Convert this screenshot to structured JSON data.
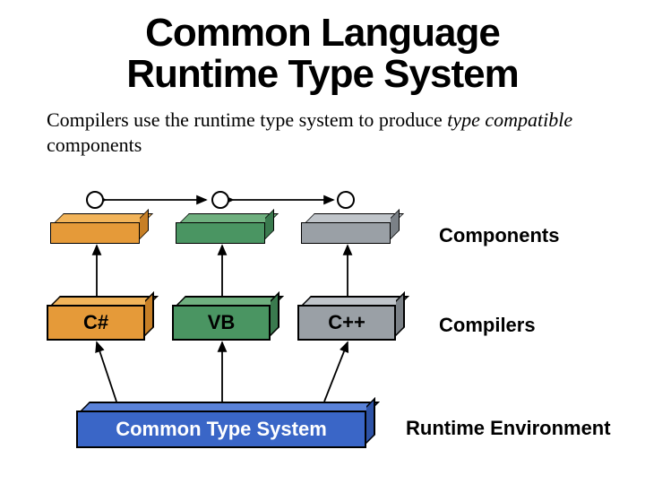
{
  "title_line1": "Common Language",
  "title_line2": "Runtime Type System",
  "subtitle_plain1": "Compilers use the runtime type system to produce ",
  "subtitle_emph": "type compatible",
  "subtitle_plain2": " components",
  "labels": {
    "components": "Components",
    "compilers": "Compilers",
    "runtime_env": "Runtime Environment"
  },
  "compilers": {
    "csharp": "C#",
    "vb": "VB",
    "cpp": "C++"
  },
  "cts": "Common Type System"
}
